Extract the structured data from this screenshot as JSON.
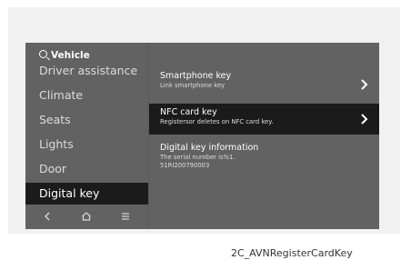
{
  "sidebar": {
    "title": "Vehicle",
    "items": [
      {
        "label": "Driver assistance"
      },
      {
        "label": "Climate"
      },
      {
        "label": "Seats"
      },
      {
        "label": "Lights"
      },
      {
        "label": "Door"
      },
      {
        "label": "Digital key",
        "selected": true
      }
    ],
    "nav": {
      "back_icon": "chevron-left-icon",
      "home_icon": "home-icon",
      "menu_icon": "menu-icon"
    }
  },
  "content": {
    "rows": [
      {
        "title": "Smartphone key",
        "subtitle": "Link smartphone key",
        "has_chevron": true
      },
      {
        "title": "NFC card key",
        "subtitle": "Registersor deletes on NFC card key.",
        "has_chevron": true,
        "selected": true
      },
      {
        "title": "Digital key information",
        "subtitle": "The serial number is%1.",
        "subtitle2": "51RI200790003",
        "has_chevron": false
      }
    ]
  },
  "caption": "2C_AVNRegisterCardKey",
  "colors": {
    "screen_bg": "#626262",
    "selected_bg": "#1b1b1b",
    "bezel_bg": "#f1f1f1",
    "text": "#ffffff"
  }
}
